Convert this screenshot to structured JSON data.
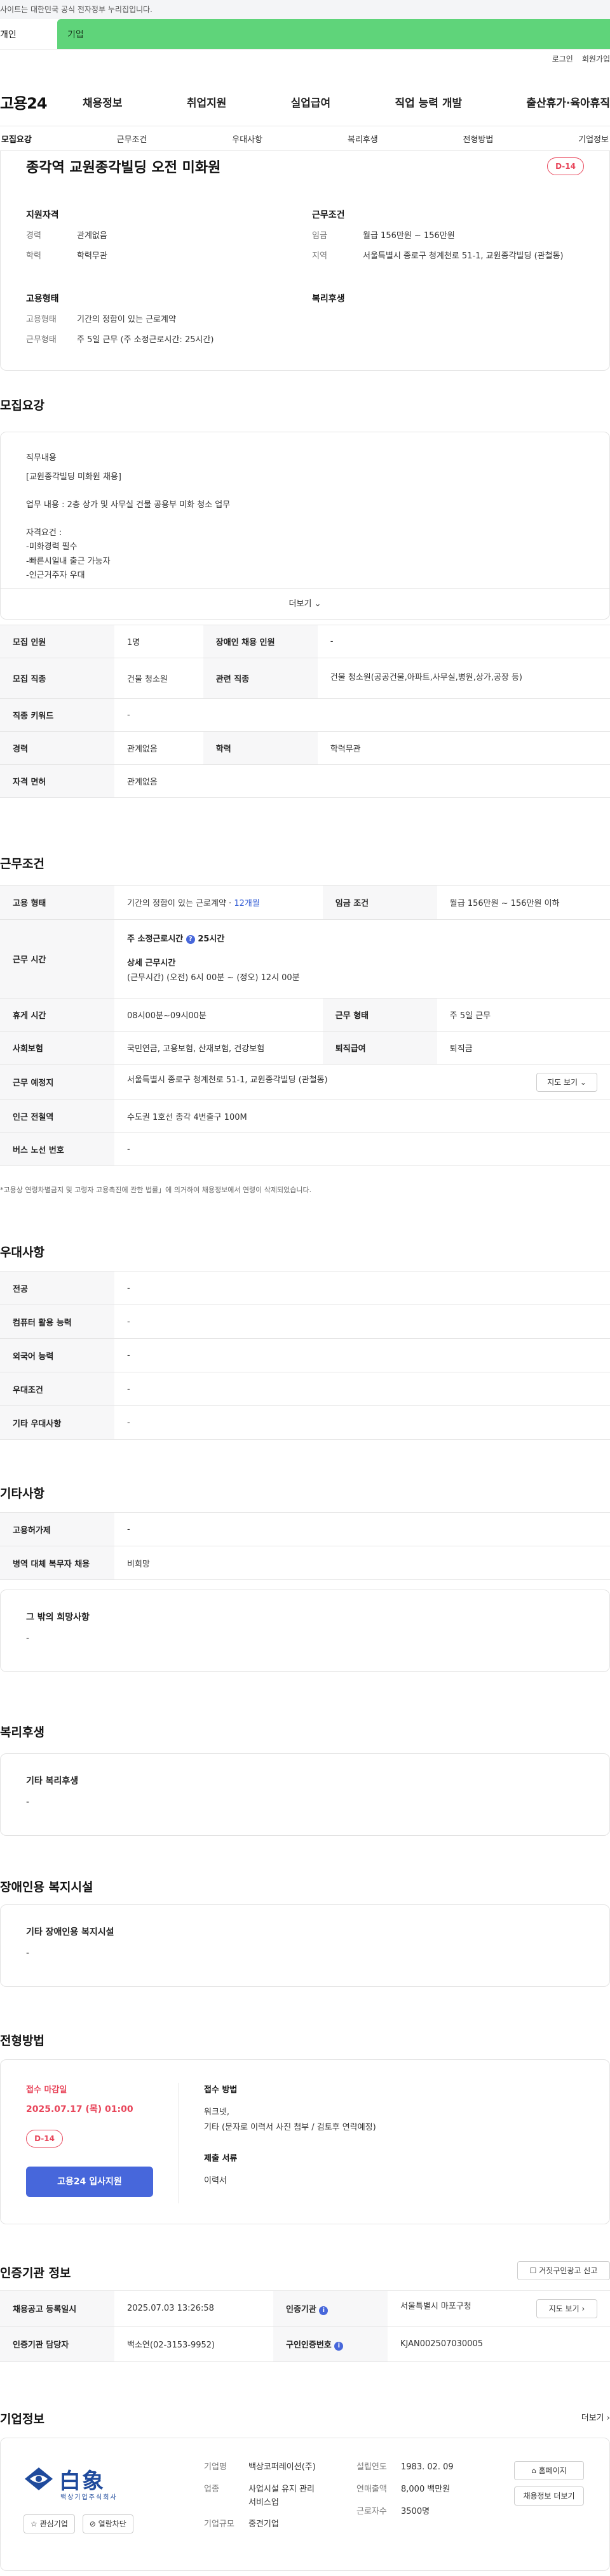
{
  "gov_bar": "사이트는 대한민국 공식 전자정부 누리집입니다.",
  "user_tabs": {
    "person": "개인",
    "company": "기업"
  },
  "util_links": [
    "로그인",
    "회원가입"
  ],
  "gnb": {
    "logo": "고용24",
    "menu": [
      "채용정보",
      "취업지원",
      "실업급여",
      "직업 능력 개발",
      "출산휴가·육아휴직"
    ]
  },
  "subnav": [
    "모집요강",
    "근무조건",
    "우대사항",
    "복리후생",
    "전형방법",
    "기업정보"
  ],
  "summary": {
    "title": "종각역 교원종각빌딩 오전 미화원",
    "dday": "D-14",
    "qualification": {
      "heading": "지원자격",
      "rows": [
        {
          "k": "경력",
          "v": "관계없음"
        },
        {
          "k": "학력",
          "v": "학력무관"
        }
      ]
    },
    "conditions": {
      "heading": "근무조건",
      "rows": [
        {
          "k": "임금",
          "v": "월급 156만원 ~ 156만원"
        },
        {
          "k": "지역",
          "v": "서울특별시 종로구 청계천로 51-1, 교원종각빌딩 (관철동)"
        }
      ]
    },
    "employment": {
      "heading": "고용형태",
      "rows": [
        {
          "k": "고용형태",
          "v": "기간의 정함이 있는 근로계약"
        },
        {
          "k": "근무형태",
          "v": "주 5일 근무 (주 소정근로시간: 25시간)"
        }
      ]
    },
    "welfare_heading": "복리후생"
  },
  "recruit": {
    "section_title": "모집요강",
    "desc_label": "직무내용",
    "desc": "[교원종각빌딩 미화원 채용]\n\n업무 내용 : 2층 상가 및 사무실 건물 공용부 미화 청소 업무\n\n자격요건 :\n-미화경력 필수\n-빠른시일내 출근 가능자\n-인근거주자 우대",
    "more": "더보기",
    "table": {
      "r1": {
        "k1": "모집 인원",
        "v1": "1명",
        "k2": "장애인 채용 인원",
        "v2": "-"
      },
      "r2": {
        "k1": "모집 직종",
        "v1": "건물 청소원",
        "k2": "관련 직종",
        "v2": "건물 청소원(공공건물,아파트,사무실,병원,상가,공장 등)"
      },
      "r3": {
        "k1": "직종 키워드",
        "v1": "-"
      },
      "r4": {
        "k1": "경력",
        "v1": "관계없음",
        "k2": "학력",
        "v2": "학력무관"
      },
      "r5": {
        "k1": "자격 면허",
        "v1": "관계없음"
      }
    }
  },
  "work": {
    "section_title": "근무조건",
    "emp_type_k": "고용 형태",
    "emp_type_v": "기간의 정함이 있는 근로계약 · ",
    "emp_type_months": "12개월",
    "wage_k": "임금 조건",
    "wage_v": "월급 156만원 ~ 156만원 이하",
    "hours_k": "근무 시간",
    "weekly_label": "주 소정근로시간",
    "weekly_value": "25시간",
    "detail_label": "상세 근무시간",
    "detail_value": "(근무시간) (오전) 6시 00분 ~ (정오) 12시 00분",
    "break_k": "휴게 시간",
    "break_v": "08시00분~09시00분",
    "shape_k": "근무 형태",
    "shape_v": "주 5일 근무",
    "insurance_k": "사회보험",
    "insurance_v": "국민연금, 고용보험, 산재보험, 건강보험",
    "severance_k": "퇴직급여",
    "severance_v": "퇴직금",
    "place_k": "근무 예정지",
    "place_v": "서울특별시 종로구 청계천로 51-1, 교원종각빌딩 (관철동)",
    "map_btn": "지도 보기",
    "subway_k": "인근 전철역",
    "subway_v": "수도권 1호선 종각 4번출구 100M",
    "bus_k": "버스 노선 번호",
    "bus_v": "-",
    "note": "*고용상 연령차별금지 및 고령자 고용촉진에 관한 법률」에 의거하여 채용정보에서 연령이 삭제되었습니다."
  },
  "pref": {
    "section_title": "우대사항",
    "rows": [
      {
        "k": "전공",
        "v": "-"
      },
      {
        "k": "컴퓨터 활용 능력",
        "v": "-"
      },
      {
        "k": "외국어 능력",
        "v": "-"
      },
      {
        "k": "우대조건",
        "v": "-"
      },
      {
        "k": "기타 우대사항",
        "v": "-"
      }
    ]
  },
  "etc": {
    "section_title": "기타사항",
    "rows": [
      {
        "k": "고용허가제",
        "v": "-"
      },
      {
        "k": "병역 대체 복무자 채용",
        "v": "비희망"
      }
    ],
    "other_label": "그 밖의 희망사항",
    "other_value": "-"
  },
  "welfare": {
    "section_title": "복리후생",
    "label": "기타 복리후생",
    "value": "-"
  },
  "disability": {
    "section_title": "장애인용 복지시설",
    "label": "기타 장애인용 복지시설",
    "value": "-"
  },
  "process": {
    "section_title": "전형방법",
    "deadline_label": "접수 마감일",
    "deadline": "2025.07.17 (목) 01:00",
    "dday": "D-14",
    "apply_btn": "고용24 입사지원",
    "method_label": "접수 방법",
    "method_v1": "워크넷,",
    "method_v2": "기타 (문자로 이력서 사진 첨부 / 검토후 연락예정)",
    "docs_label": "제출 서류",
    "docs_value": "이력서"
  },
  "agency": {
    "section_title": "인증기관 정보",
    "report_btn": "거짓구인광고 신고",
    "reg_k": "채용공고 등록일시",
    "reg_v": "2025.07.03 13:26:58",
    "agency_k": "인증기관",
    "agency_v": "서울특별시 마포구청",
    "map_btn": "지도 보기",
    "contact_k": "인증기관 담당자",
    "contact_v": "백소연(02-3153-9952)",
    "cert_k": "구인인증번호",
    "cert_v": "KJAN002507030005"
  },
  "company": {
    "section_title": "기업정보",
    "more": "더보기",
    "logo_text": "白象",
    "logo_sub": "백상기업주식회사",
    "btn_interest": "관심기업",
    "btn_block": "열람차단",
    "name_k": "기업명",
    "name_v": "백상코퍼레이션(주)",
    "biz_k": "업종",
    "biz_v": "사업시설 유지 관리 서비스업",
    "size_k": "기업규모",
    "size_v": "중견기업",
    "est_k": "설립연도",
    "est_v": "1983. 02. 09",
    "sales_k": "연매출액",
    "sales_v": "8,000 백만원",
    "emp_k": "근로자수",
    "emp_v": "3500명",
    "homepage_btn": "홈페이지",
    "jobs_btn": "채용정보 더보기"
  }
}
